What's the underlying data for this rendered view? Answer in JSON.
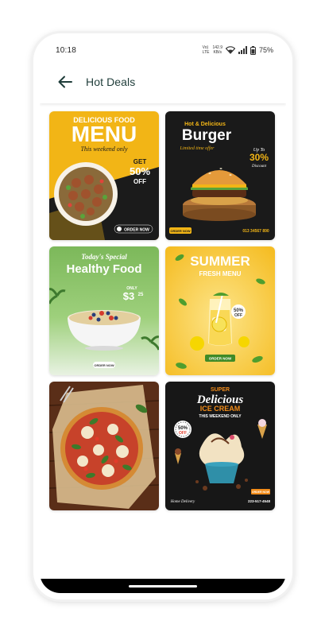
{
  "status_bar": {
    "time": "10:18",
    "network_top": "Vo)",
    "network_bottom": "LTE",
    "speed_value": "142.9",
    "speed_unit": "KB/s",
    "battery": "75%"
  },
  "app_bar": {
    "title": "Hot Deals",
    "back_icon": "arrow-left-icon"
  },
  "deals": [
    {
      "id": "menu",
      "line1": "DELICIOUS FOOD",
      "line2": "MENU",
      "line3": "This weekend only",
      "offer_top": "GET",
      "offer_value": "50%",
      "offer_bottom": "OFF",
      "cta": "ORDER NOW",
      "accent": "#f2b516"
    },
    {
      "id": "burger",
      "line1": "Hot & Delicious",
      "line2": "Burger",
      "line3": "Limited time offer",
      "offer_top": "Up To",
      "offer_value": "30%",
      "offer_bottom": "Discount",
      "cta": "ORDER NOW",
      "phone": "013 34567 890",
      "accent": "#f2b516"
    },
    {
      "id": "healthy",
      "line1": "Today's Special",
      "line2": "Healthy Food",
      "offer_top": "ONLY",
      "offer_value": "$3",
      "offer_cents": "25",
      "cta": "ORDER NOW",
      "accent": "#7cb85a"
    },
    {
      "id": "summer",
      "line1": "SUMMER",
      "line2": "FRESH MENU",
      "offer_value": "50%",
      "offer_bottom": "OFF",
      "cta": "ORDER NOW",
      "accent": "#f7c832"
    },
    {
      "id": "pizza",
      "accent": "#6b3a22"
    },
    {
      "id": "icecream",
      "line1": "SUPER",
      "line2": "Delicious",
      "line3": "ICE CREAM",
      "line4": "THIS WEEKEND ONLY",
      "offer_value": "50%",
      "offer_bottom": "OFF",
      "cta": "ORDER NOW",
      "phone": "223-517-4548",
      "footer": "Home Delivery",
      "accent": "#f28c1a"
    }
  ]
}
